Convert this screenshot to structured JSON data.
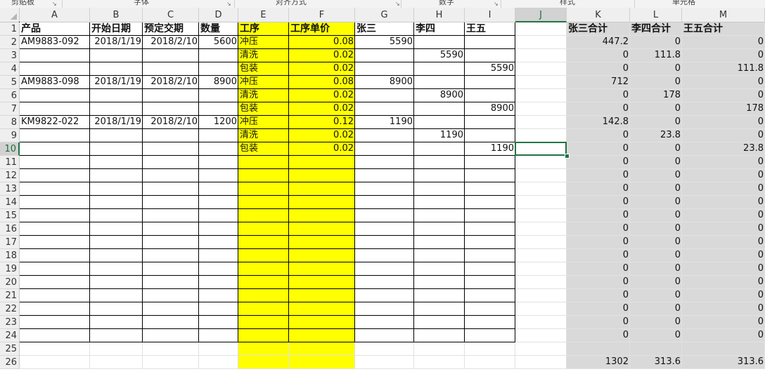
{
  "ribbon": {
    "groups": [
      "剪贴板",
      "字体",
      "对齐方式",
      "数字",
      "样式",
      "单元格"
    ]
  },
  "columns": [
    "A",
    "B",
    "C",
    "D",
    "E",
    "F",
    "G",
    "H",
    "I",
    "J",
    "K",
    "L",
    "M"
  ],
  "rows": [
    "1",
    "2",
    "3",
    "4",
    "5",
    "6",
    "7",
    "8",
    "9",
    "10",
    "11",
    "12",
    "13",
    "14",
    "15",
    "16",
    "17",
    "18",
    "19",
    "20",
    "21",
    "22",
    "23",
    "24",
    "25",
    "26"
  ],
  "active_cell": "J10",
  "colors": {
    "yellow": "#ffff00",
    "gray": "#d9d9d9",
    "accent": "#217346"
  },
  "headers": {
    "A": "产品",
    "B": "开始日期",
    "C": "预定交期",
    "D": "数量",
    "E": "工序",
    "F": "工序单价",
    "G": "张三",
    "H": "李四",
    "I": "王五",
    "K": "张三合计",
    "L": "李四合计",
    "M": "王五合计"
  },
  "products": [
    {
      "row": 2,
      "product": "AM9883-092",
      "start": "2018/1/19",
      "due": "2018/2/10",
      "qty": "5600"
    },
    {
      "row": 5,
      "product": "AM9883-098",
      "start": "2018/1/19",
      "due": "2018/2/10",
      "qty": "8900"
    },
    {
      "row": 8,
      "product": "KM9822-022",
      "start": "2018/1/19",
      "due": "2018/2/10",
      "qty": "1200"
    }
  ],
  "processes": [
    {
      "row": 2,
      "name": "冲压",
      "price": "0.08",
      "G": "5590",
      "H": "",
      "I": ""
    },
    {
      "row": 3,
      "name": "清洗",
      "price": "0.02",
      "G": "",
      "H": "5590",
      "I": ""
    },
    {
      "row": 4,
      "name": "包装",
      "price": "0.02",
      "G": "",
      "H": "",
      "I": "5590"
    },
    {
      "row": 5,
      "name": "冲压",
      "price": "0.08",
      "G": "8900",
      "H": "",
      "I": ""
    },
    {
      "row": 6,
      "name": "清洗",
      "price": "0.02",
      "G": "",
      "H": "8900",
      "I": ""
    },
    {
      "row": 7,
      "name": "包装",
      "price": "0.02",
      "G": "",
      "H": "",
      "I": "8900"
    },
    {
      "row": 8,
      "name": "冲压",
      "price": "0.12",
      "G": "1190",
      "H": "",
      "I": ""
    },
    {
      "row": 9,
      "name": "清洗",
      "price": "0.02",
      "G": "",
      "H": "1190",
      "I": ""
    },
    {
      "row": 10,
      "name": "包装",
      "price": "0.02",
      "G": "",
      "H": "",
      "I": "1190"
    }
  ],
  "totals": [
    [
      "447.2",
      "0",
      "0"
    ],
    [
      "0",
      "111.8",
      "0"
    ],
    [
      "0",
      "0",
      "111.8"
    ],
    [
      "712",
      "0",
      "0"
    ],
    [
      "0",
      "178",
      "0"
    ],
    [
      "0",
      "0",
      "178"
    ],
    [
      "142.8",
      "0",
      "0"
    ],
    [
      "0",
      "23.8",
      "0"
    ],
    [
      "0",
      "0",
      "23.8"
    ],
    [
      "0",
      "0",
      "0"
    ],
    [
      "0",
      "0",
      "0"
    ],
    [
      "0",
      "0",
      "0"
    ],
    [
      "0",
      "0",
      "0"
    ],
    [
      "0",
      "0",
      "0"
    ],
    [
      "0",
      "0",
      "0"
    ],
    [
      "0",
      "0",
      "0"
    ],
    [
      "0",
      "0",
      "0"
    ],
    [
      "0",
      "0",
      "0"
    ],
    [
      "0",
      "0",
      "0"
    ],
    [
      "0",
      "0",
      "0"
    ],
    [
      "0",
      "0",
      "0"
    ],
    [
      "0",
      "0",
      "0"
    ],
    [
      "0",
      "0",
      "0"
    ]
  ],
  "grand_totals": [
    "1302",
    "313.6",
    "313.6"
  ]
}
